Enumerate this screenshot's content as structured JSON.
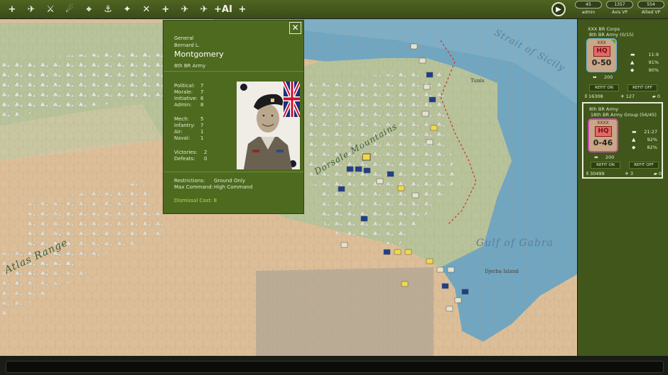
{
  "toolbar": {
    "buttons": [
      {
        "name": "aircraft-mission-icon",
        "glyph": "+"
      },
      {
        "name": "air-transfer-icon",
        "glyph": "✈"
      },
      {
        "name": "air-attack-icon",
        "glyph": "⚔"
      },
      {
        "name": "air-bombard-icon",
        "glyph": "☄"
      },
      {
        "name": "air-recon-icon",
        "glyph": "⌖"
      },
      {
        "name": "naval-strike-icon",
        "glyph": "⚓"
      },
      {
        "name": "ground-support-icon",
        "glyph": "✦"
      },
      {
        "name": "interdiction-icon",
        "glyph": "✕"
      },
      {
        "name": "add-hq-icon",
        "glyph": "+"
      },
      {
        "name": "air-ai-icon",
        "glyph": "✈"
      },
      {
        "name": "air-ai-2-icon",
        "glyph": "✈"
      },
      {
        "name": "add-ai-icon",
        "glyph": "+AI"
      },
      {
        "name": "add-unit-icon",
        "glyph": "+"
      }
    ],
    "stats": [
      {
        "value": "45",
        "label": "admin"
      },
      {
        "value": "1357",
        "label": "Axis VP"
      },
      {
        "value": "554",
        "label": "Allied VP"
      }
    ]
  },
  "map": {
    "labels": {
      "strait": "Strait of Sicily",
      "gulf": "Gulf of Gabra",
      "island": "Djerba Island",
      "range": "Atlas Range",
      "mountains": "Dorsale Mountains",
      "town": "Tunis"
    }
  },
  "leader": {
    "rank": "General",
    "first_name": "Bernard L.",
    "last_name": "Montgomery",
    "army": "8th BR Army",
    "attributes": [
      {
        "k": "Political:",
        "v": "7"
      },
      {
        "k": "Morale:",
        "v": "7"
      },
      {
        "k": "Initiative:",
        "v": "6"
      },
      {
        "k": "Admin:",
        "v": "8"
      }
    ],
    "skills": [
      {
        "k": "Mech:",
        "v": "5"
      },
      {
        "k": "Infantry:",
        "v": "7"
      },
      {
        "k": "Air:",
        "v": "1"
      },
      {
        "k": "Naval:",
        "v": "1"
      }
    ],
    "record": [
      {
        "k": "Victories:",
        "v": "2"
      },
      {
        "k": "Defeats:",
        "v": "0"
      }
    ],
    "restrictions_label": "Restrictions:",
    "restrictions_value": "Ground Only",
    "max_command_label": "Max Command:",
    "max_command_value": "High Command",
    "dismissal": "Dismissal Cost: 8",
    "close": "✕"
  },
  "hq_panel": [
    {
      "line1": "XXX BR Corps",
      "line2": "8th BR Army (0/15)",
      "size": "XXX",
      "hq": "HQ",
      "strength": "0-50",
      "supply": "200",
      "mor": "11:9",
      "eff": "91%",
      "exp": "90%",
      "refit_on": "REFIT ON",
      "refit_off": "REFIT OFF",
      "men": "16308",
      "air": "127",
      "tanks": "0",
      "selected": false
    },
    {
      "line1": "8th BR Army",
      "line2": "18th BR Army Group (56/45)",
      "size": "XXXX",
      "hq": "HQ",
      "strength": "0-46",
      "supply": "200",
      "mor": "21:27",
      "eff": "92%",
      "exp": "82%",
      "refit_on": "REFIT ON",
      "refit_off": "REFIT OFF",
      "men": "30499",
      "air": "3",
      "tanks": "0",
      "selected": true
    }
  ],
  "colors": {
    "toolbar": "#4a5e1f",
    "panel": "#4d6a1f",
    "sea": "#6fa6c2",
    "desert": "#dcbf99",
    "grass": "#b7c39a"
  }
}
